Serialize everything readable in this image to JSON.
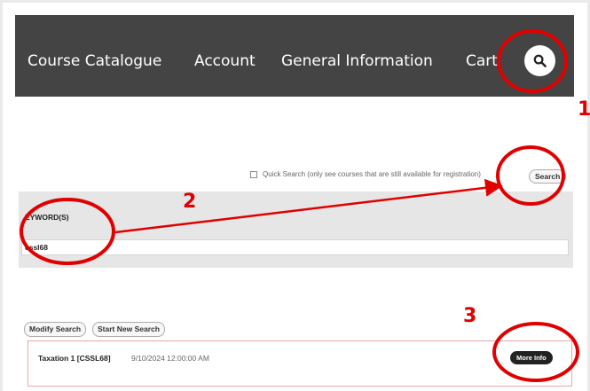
{
  "nav": {
    "items": [
      "Course Catalogue",
      "Account",
      "General Information",
      "Cart"
    ],
    "search_icon": "magnifier-icon",
    "bar_color": "#444444"
  },
  "search": {
    "quick_search_label": "Quick Search (only see courses that are still available for registration)",
    "search_button": "Search"
  },
  "keyword": {
    "label": "EYWORD(S)",
    "value": "cssl68"
  },
  "results": {
    "modify_button": "Modify Search",
    "new_search_button": "Start New Search",
    "rows": [
      {
        "title": "Taxation 1 [CSSL68]",
        "date": "9/10/2024 12:00:00 AM",
        "more_info": "More Info"
      }
    ]
  },
  "annotations": {
    "color": "#e00000",
    "labels": [
      "1",
      "2",
      "3"
    ]
  }
}
